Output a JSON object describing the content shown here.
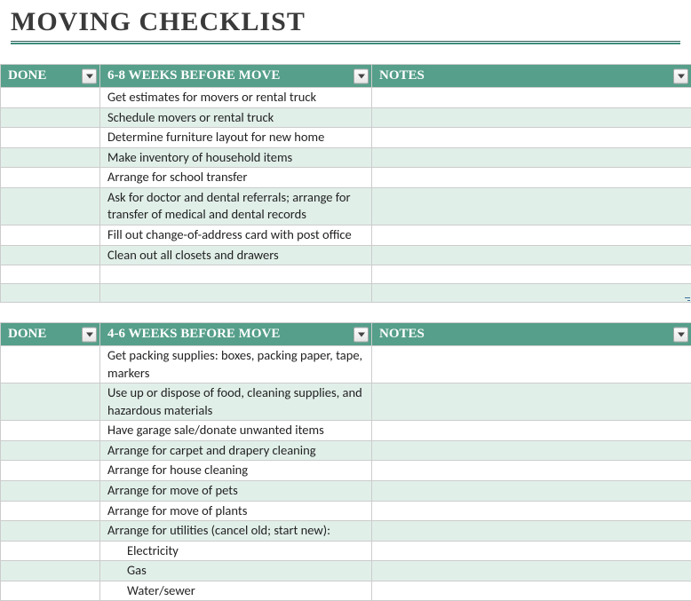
{
  "title": "MOVING CHECKLIST",
  "columns": {
    "done": "DONE",
    "notes": "NOTES"
  },
  "sections": [
    {
      "heading": "6-8 WEEKS BEFORE MOVE",
      "rows": [
        {
          "task": "Get estimates for movers or rental truck"
        },
        {
          "task": "Schedule movers or rental truck"
        },
        {
          "task": "Determine furniture layout for new home"
        },
        {
          "task": "Make inventory of household items"
        },
        {
          "task": "Arrange for school transfer"
        },
        {
          "task": "Ask for doctor and dental referrals; arrange for transfer of medical and dental records"
        },
        {
          "task": "Fill out change-of-address card with post office"
        },
        {
          "task": "Clean out all closets and drawers"
        },
        {
          "task": ""
        },
        {
          "task": ""
        }
      ]
    },
    {
      "heading": "4-6 WEEKS BEFORE MOVE",
      "rows": [
        {
          "task": "Get packing supplies: boxes, packing paper, tape, markers"
        },
        {
          "task": "Use up or dispose of food, cleaning supplies, and hazardous materials"
        },
        {
          "task": "Have garage sale/donate unwanted items"
        },
        {
          "task": "Arrange for carpet and drapery cleaning"
        },
        {
          "task": "Arrange for house cleaning"
        },
        {
          "task": "Arrange for move of pets"
        },
        {
          "task": "Arrange for move of plants"
        },
        {
          "task": "Arrange for utilities (cancel old; start new):"
        },
        {
          "task": "Electricity",
          "indent": true
        },
        {
          "task": "Gas",
          "indent": true
        },
        {
          "task": "Water/sewer",
          "indent": true
        }
      ]
    }
  ]
}
